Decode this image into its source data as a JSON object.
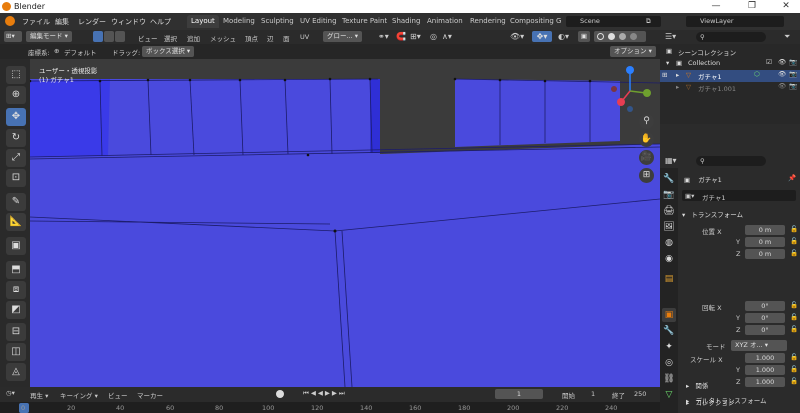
{
  "window": {
    "title": "Blender",
    "min": "—",
    "max": "❐",
    "close": "✕"
  },
  "menu": [
    "ファイル",
    "編集",
    "レンダー",
    "ウィンドウ",
    "ヘルプ"
  ],
  "workspaces": [
    "Layout",
    "Modeling",
    "Sculpting",
    "UV Editing",
    "Texture Paint",
    "Shading",
    "Animation",
    "Rendering",
    "Compositing",
    "G"
  ],
  "scene": {
    "name": "Scene",
    "view_layer": "ViewLayer"
  },
  "header": {
    "mode": "編集モード",
    "menus": [
      "ビュー",
      "選択",
      "追加",
      "メッシュ",
      "頂点",
      "辺",
      "面",
      "UV"
    ],
    "orientation": "グロー...",
    "coord_label": "座標系:",
    "coord_value": "デフォルト",
    "drag_label": "ドラッグ:",
    "drag_value": "ボックス選択",
    "options": "オプション"
  },
  "viewport": {
    "view_name": "ユーザー・透視投影",
    "object_name": "(1) ガチャ1"
  },
  "outliner": {
    "root": "シーンコレクション",
    "collection": "Collection",
    "items": [
      "ガチャ1",
      "ガチャ1.001"
    ]
  },
  "properties": {
    "object_name": "ガチャ1",
    "mesh_name": "ガチャ1",
    "transform_title": "トランスフォーム",
    "location_label": "位置 X",
    "rotation_label": "回転 X",
    "scale_label": "スケール X",
    "y": "Y",
    "z": "Z",
    "loc": [
      "0 m",
      "0 m",
      "0 m"
    ],
    "rot": [
      "0°",
      "0°",
      "0°"
    ],
    "scale": [
      "1.000",
      "1.000",
      "1.000"
    ],
    "mode_label": "モード",
    "mode_value": "XYZ オ...",
    "delta": "デルタトランスフォーム",
    "relations": "関係",
    "collections": "コレクション"
  },
  "timeline": {
    "playback": "再生",
    "keying": "キーイング",
    "view": "ビュー",
    "marker": "マーカー",
    "current": "1",
    "start_label": "開始",
    "start": "1",
    "end_label": "終了",
    "end": "250",
    "ticks": [
      "0",
      "20",
      "40",
      "60",
      "80",
      "100",
      "120",
      "140",
      "160",
      "180",
      "200",
      "220",
      "240"
    ]
  },
  "colors": {
    "accent": "#4772b3",
    "mesh_face": "#4a4add",
    "active_orange": "#e87d0d"
  }
}
